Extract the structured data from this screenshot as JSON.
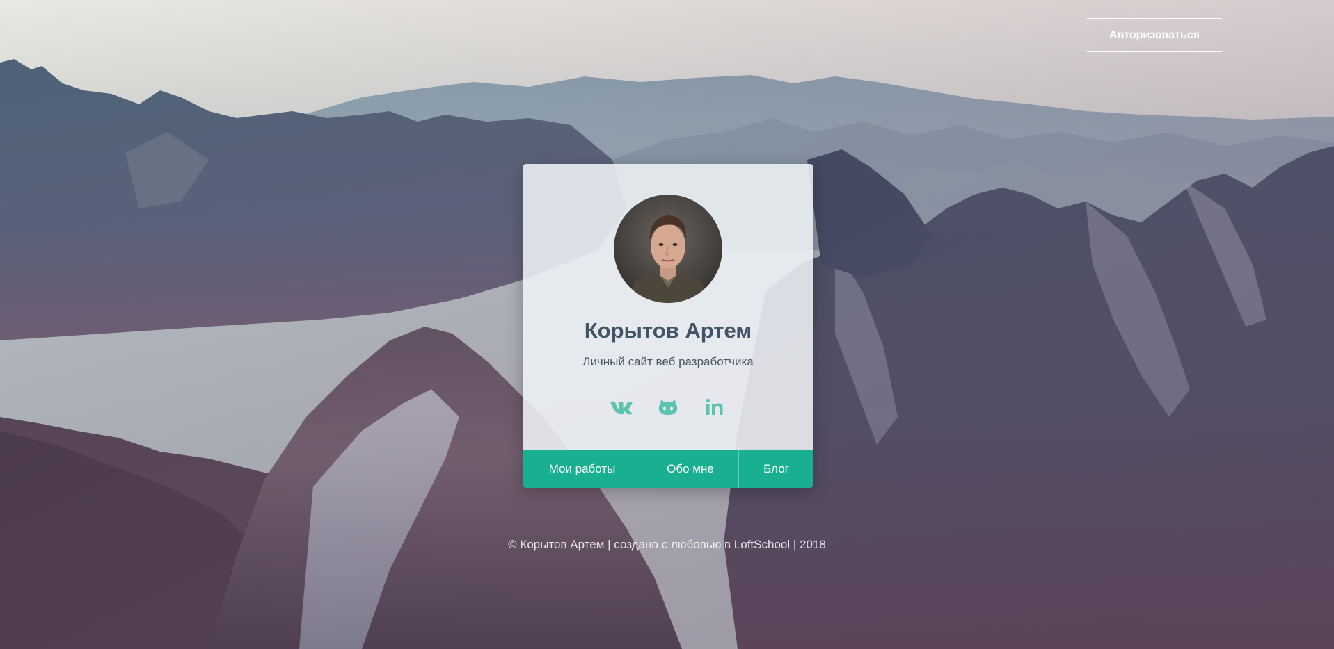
{
  "header": {
    "auth_label": "Авторизоваться"
  },
  "card": {
    "name": "Корытов Артем",
    "subtitle": "Личный сайт веб разработчика",
    "socials": [
      {
        "icon": "vk-icon"
      },
      {
        "icon": "github-icon"
      },
      {
        "icon": "linkedin-icon"
      }
    ],
    "nav": [
      {
        "label": "Мои работы"
      },
      {
        "label": "Обо мне"
      },
      {
        "label": "Блог"
      }
    ]
  },
  "footer": {
    "text": "© Корытов Артем | создано с любовью в LoftSchool | 2018"
  },
  "colors": {
    "accent": "#19b092",
    "social_icon": "#5cc3b0",
    "name_text": "#435466",
    "card_bg": "#eef1f5"
  }
}
